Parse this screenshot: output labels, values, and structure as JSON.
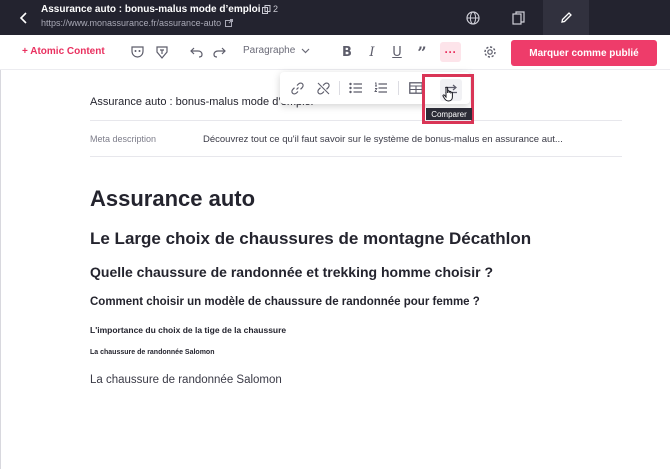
{
  "header": {
    "title": "Assurance auto : bonus-malus mode d’emploi",
    "copies_count": "2",
    "url": "https://www.monassurance.fr/assurance-auto"
  },
  "toolbar": {
    "atomic_content": "+ Atomic Content",
    "paragraph_select": "Paragraphe",
    "more_label": "···",
    "publish_label": "Marquer comme publié"
  },
  "popup": {
    "tooltip": "Comparer"
  },
  "meta": {
    "title_value": "Assurance auto : bonus-malus mode d’emploi",
    "description_label": "Meta description",
    "description_value": "Découvrez tout ce qu'il faut savoir sur le système de bonus-malus en assurance aut..."
  },
  "content": {
    "h1": "Assurance auto",
    "h2": "Le Large choix de chaussures de montagne Décathlon",
    "h3": "Quelle chaussure de randonnée et trekking homme choisir ?",
    "h4": "Comment choisir un modèle de chaussure de randonnée pour femme ?",
    "h5": "L'importance du choix de la tige de la chaussure",
    "h6": "La chaussure de randonnée Salomon",
    "paragraph": "La chaussure de randonnée Salomon"
  },
  "colors": {
    "accent": "#ee3c6a",
    "header_bg": "#23232f",
    "highlight": "#d93556"
  }
}
